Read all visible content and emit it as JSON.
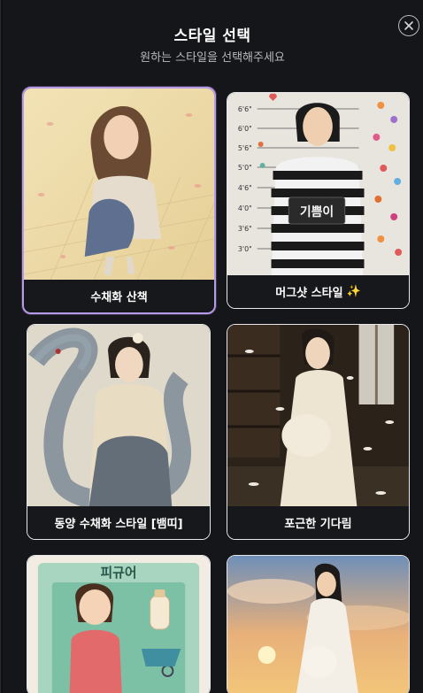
{
  "modal": {
    "title": "스타일 선택",
    "subtitle": "원하는 스타일을 선택해주세요"
  },
  "styles": [
    {
      "label": "수채화 산책",
      "selected": true
    },
    {
      "label": "머그샷 스타일",
      "badge_icon": "sparkles-icon",
      "sign_text": "기쁨이",
      "height_marks": [
        "6'6\"",
        "6'0\"",
        "5'6\"",
        "5'0\"",
        "4'6\"",
        "4'0\"",
        "3'6\"",
        "3'0\""
      ]
    },
    {
      "label": "동양 수채화 스타일 [뱀띠]"
    },
    {
      "label": "포근한 기다림"
    },
    {
      "label": "",
      "box_title": "피규어"
    },
    {
      "label": ""
    }
  ],
  "colors": {
    "accent": "#b79ae8",
    "background": "#151619",
    "label_bg": "#17181b"
  }
}
